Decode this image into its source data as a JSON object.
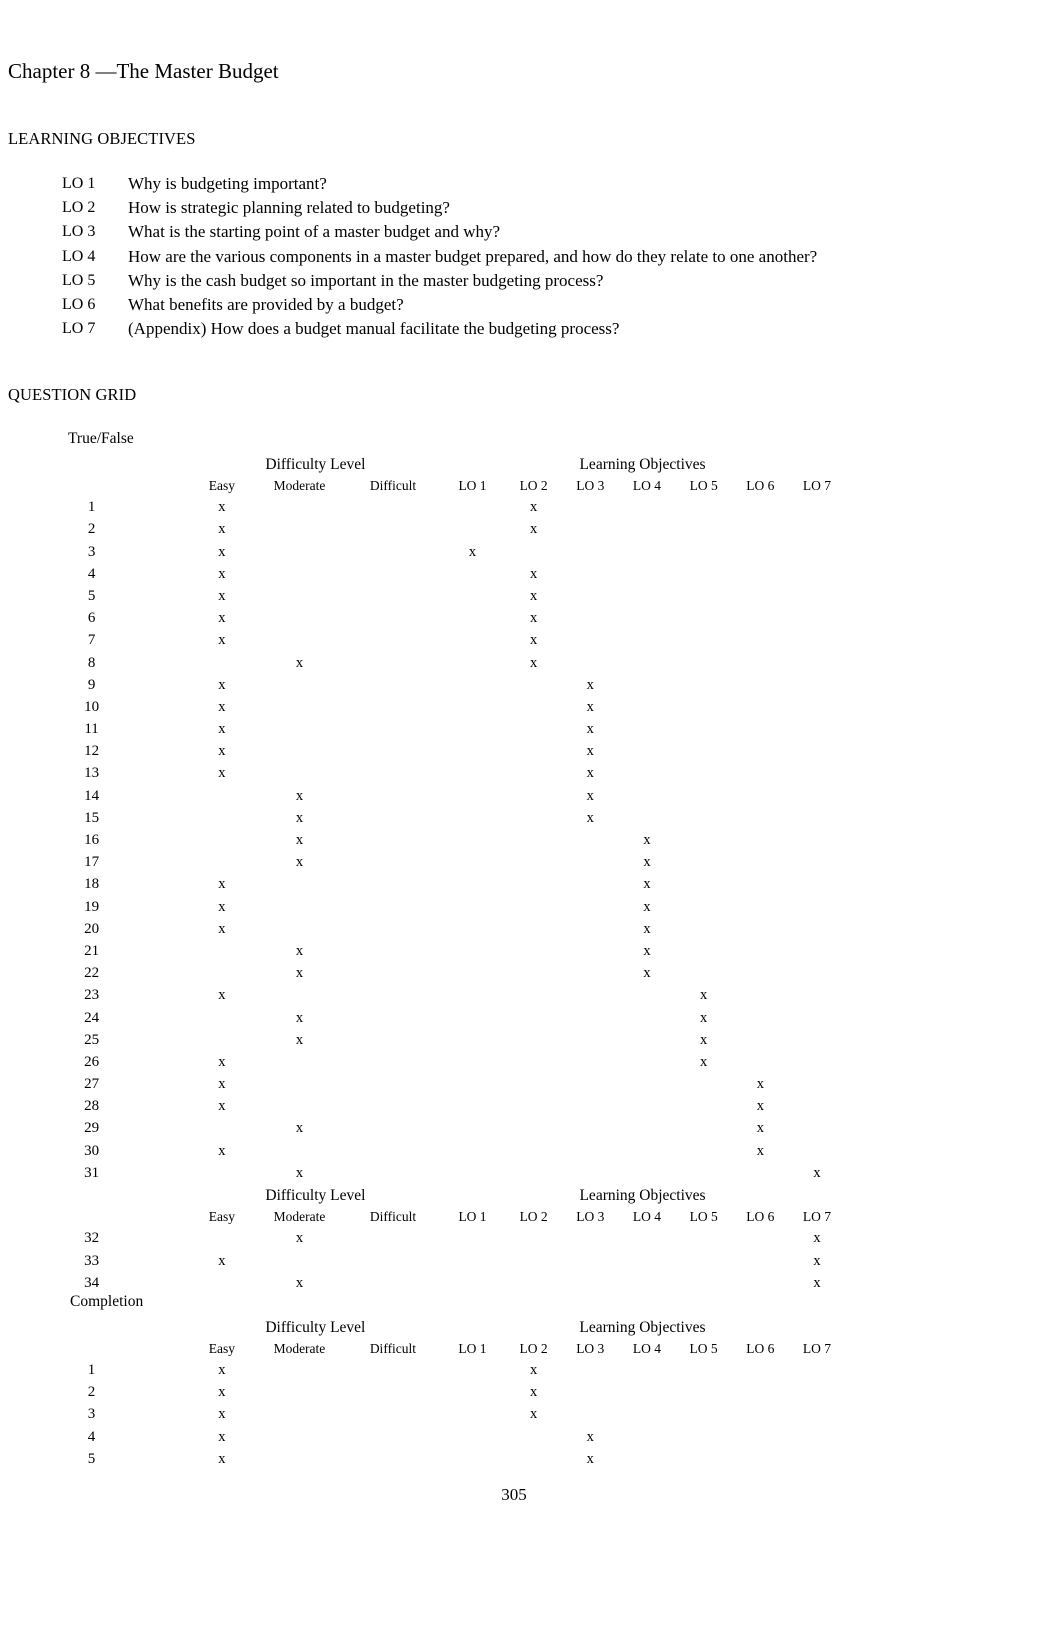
{
  "document": {
    "chapter_title": "Chapter 8 —The Master Budget",
    "page_number": "305"
  },
  "learning_objectives": {
    "heading": "LEARNING OBJECTIVES",
    "items": [
      {
        "tag": "LO 1",
        "text": "Why is budgeting important?"
      },
      {
        "tag": "LO 2",
        "text": "How is strategic planning related to budgeting?"
      },
      {
        "tag": "LO 3",
        "text": "What is the starting point of a master budget and why?"
      },
      {
        "tag": "LO 4",
        "text": "How are the various components in a master budget prepared, and how do they relate to one another?"
      },
      {
        "tag": "LO 5",
        "text": "Why is the cash budget so important in the master budgeting process?"
      },
      {
        "tag": "LO 6",
        "text": "What benefits are provided by a budget?"
      },
      {
        "tag": "LO 7",
        "text": "(Appendix) How does a budget manual facilitate the budgeting process?"
      }
    ]
  },
  "question_grid": {
    "heading": "QUESTION GRID",
    "group_headers": {
      "difficulty": "Difficulty Level",
      "objectives": "Learning Objectives"
    },
    "column_headers": [
      "Easy",
      "Moderate",
      "Difficult",
      "LO 1",
      "LO 2",
      "LO 3",
      "LO 4",
      "LO 5",
      "LO 6",
      "LO 7"
    ],
    "mark": "x",
    "sections": [
      {
        "label": "True/False",
        "blocks": [
          {
            "rows": [
              {
                "n": "1",
                "difficulty": "Easy",
                "lo": "LO 2"
              },
              {
                "n": "2",
                "difficulty": "Easy",
                "lo": "LO 2"
              },
              {
                "n": "3",
                "difficulty": "Easy",
                "lo": "LO 1"
              },
              {
                "n": "4",
                "difficulty": "Easy",
                "lo": "LO 2"
              },
              {
                "n": "5",
                "difficulty": "Easy",
                "lo": "LO 2"
              },
              {
                "n": "6",
                "difficulty": "Easy",
                "lo": "LO 2"
              },
              {
                "n": "7",
                "difficulty": "Easy",
                "lo": "LO 2"
              },
              {
                "n": "8",
                "difficulty": "Moderate",
                "lo": "LO 2"
              },
              {
                "n": "9",
                "difficulty": "Easy",
                "lo": "LO 3"
              },
              {
                "n": "10",
                "difficulty": "Easy",
                "lo": "LO 3"
              },
              {
                "n": "11",
                "difficulty": "Easy",
                "lo": "LO 3"
              },
              {
                "n": "12",
                "difficulty": "Easy",
                "lo": "LO 3"
              },
              {
                "n": "13",
                "difficulty": "Easy",
                "lo": "LO 3"
              },
              {
                "n": "14",
                "difficulty": "Moderate",
                "lo": "LO 3"
              },
              {
                "n": "15",
                "difficulty": "Moderate",
                "lo": "LO 3"
              },
              {
                "n": "16",
                "difficulty": "Moderate",
                "lo": "LO 4"
              },
              {
                "n": "17",
                "difficulty": "Moderate",
                "lo": "LO 4"
              },
              {
                "n": "18",
                "difficulty": "Easy",
                "lo": "LO 4"
              },
              {
                "n": "19",
                "difficulty": "Easy",
                "lo": "LO 4"
              },
              {
                "n": "20",
                "difficulty": "Easy",
                "lo": "LO 4"
              },
              {
                "n": "21",
                "difficulty": "Moderate",
                "lo": "LO 4"
              },
              {
                "n": "22",
                "difficulty": "Moderate",
                "lo": "LO 4"
              },
              {
                "n": "23",
                "difficulty": "Easy",
                "lo": "LO 5"
              },
              {
                "n": "24",
                "difficulty": "Moderate",
                "lo": "LO 5"
              },
              {
                "n": "25",
                "difficulty": "Moderate",
                "lo": "LO 5"
              },
              {
                "n": "26",
                "difficulty": "Easy",
                "lo": "LO 5"
              },
              {
                "n": "27",
                "difficulty": "Easy",
                "lo": "LO 6"
              },
              {
                "n": "28",
                "difficulty": "Easy",
                "lo": "LO 6"
              },
              {
                "n": "29",
                "difficulty": "Moderate",
                "lo": "LO 6"
              },
              {
                "n": "30",
                "difficulty": "Easy",
                "lo": "LO 6"
              },
              {
                "n": "31",
                "difficulty": "Moderate",
                "lo": "LO 7"
              }
            ]
          },
          {
            "rows": [
              {
                "n": "32",
                "difficulty": "Moderate",
                "lo": "LO 7"
              },
              {
                "n": "33",
                "difficulty": "Easy",
                "lo": "LO 7"
              },
              {
                "n": "34",
                "difficulty": "Moderate",
                "lo": "LO 7"
              }
            ]
          }
        ]
      },
      {
        "label": "Completion",
        "blocks": [
          {
            "rows": [
              {
                "n": "1",
                "difficulty": "Easy",
                "lo": "LO 2"
              },
              {
                "n": "2",
                "difficulty": "Easy",
                "lo": "LO 2"
              },
              {
                "n": "3",
                "difficulty": "Easy",
                "lo": "LO 2"
              },
              {
                "n": "4",
                "difficulty": "Easy",
                "lo": "LO 3"
              },
              {
                "n": "5",
                "difficulty": "Easy",
                "lo": "LO 3"
              }
            ]
          }
        ]
      }
    ]
  }
}
